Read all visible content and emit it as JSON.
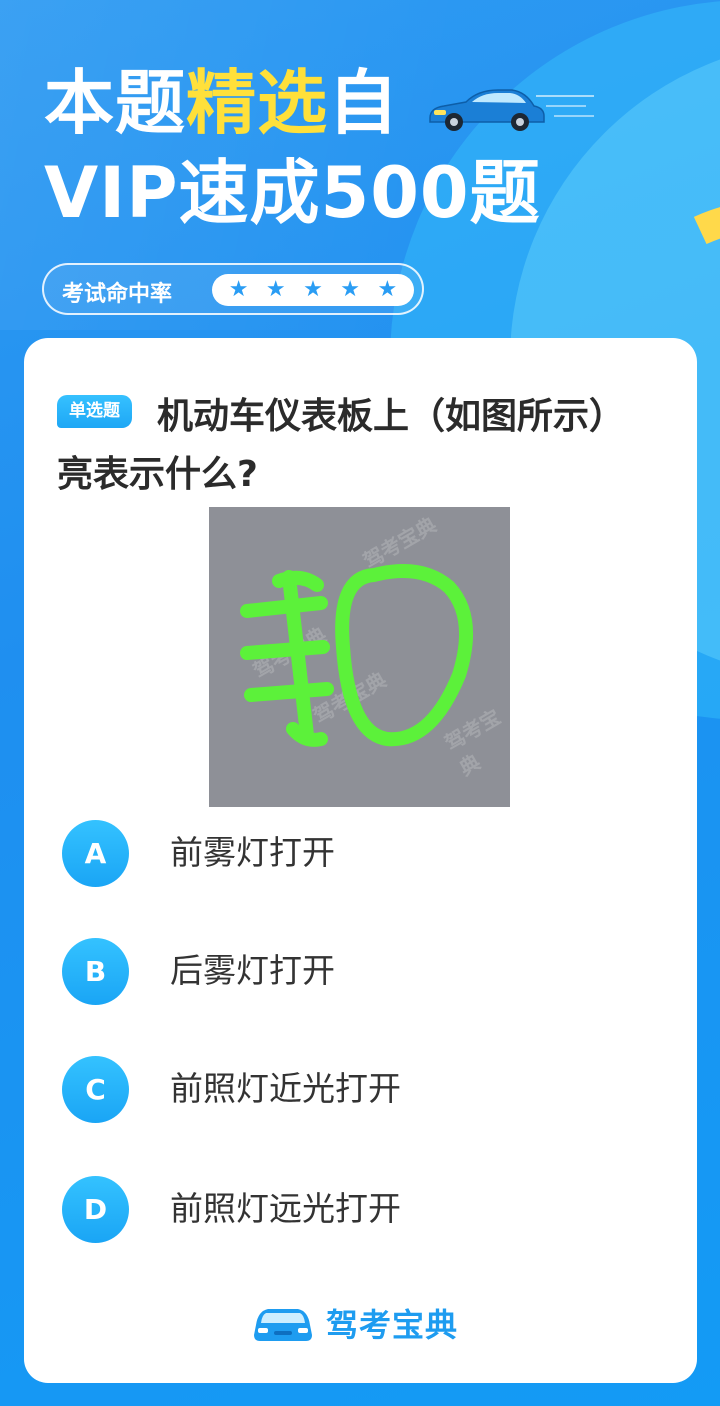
{
  "header": {
    "line1_a": "本题",
    "line1_b": "精选",
    "line1_c": "自",
    "line2": "VIP速成500题",
    "accent_color": "#ffe03a"
  },
  "rate": {
    "label": "考试命中率",
    "stars": 5
  },
  "question": {
    "type_tag": "单选题",
    "text": "机动车仪表板上（如图所示）亮表示什么?",
    "image_watermark": "驾考宝典"
  },
  "options": [
    {
      "letter": "A",
      "text": "前雾灯打开"
    },
    {
      "letter": "B",
      "text": "后雾灯打开"
    },
    {
      "letter": "C",
      "text": "前照灯近光打开"
    },
    {
      "letter": "D",
      "text": "前照灯远光打开"
    }
  ],
  "brand": {
    "name": "驾考宝典",
    "color": "#1e9cf0"
  }
}
